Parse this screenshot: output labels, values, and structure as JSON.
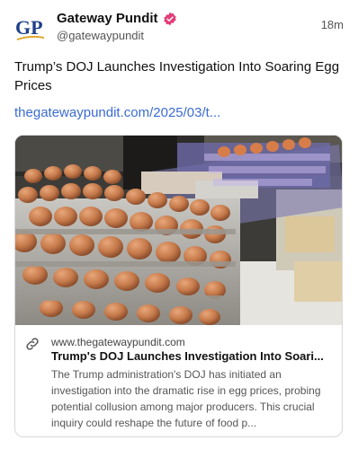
{
  "author": {
    "name": "Gateway Pundit",
    "handle": "@gatewaypundit",
    "avatar_text": "GP",
    "timestamp": "18m"
  },
  "post": {
    "text": "Trump’s DOJ Launches Investigation Into Soaring Egg Prices",
    "link": "thegatewaypundit.com/2025/03/t..."
  },
  "card": {
    "domain": "www.thegatewaypundit.com",
    "title": "Trump's DOJ Launches Investigation Into Soari...",
    "description": "The Trump administration's DOJ has initiated an investigation into the dramatic rise in egg prices, probing potential collusion among major producers. This crucial inquiry could reshape the future of food p..."
  },
  "colors": {
    "verified": "#e23d78",
    "link": "#3b6bd6",
    "brand_blue": "#1f3f8a",
    "brand_gold": "#e2a62c"
  }
}
